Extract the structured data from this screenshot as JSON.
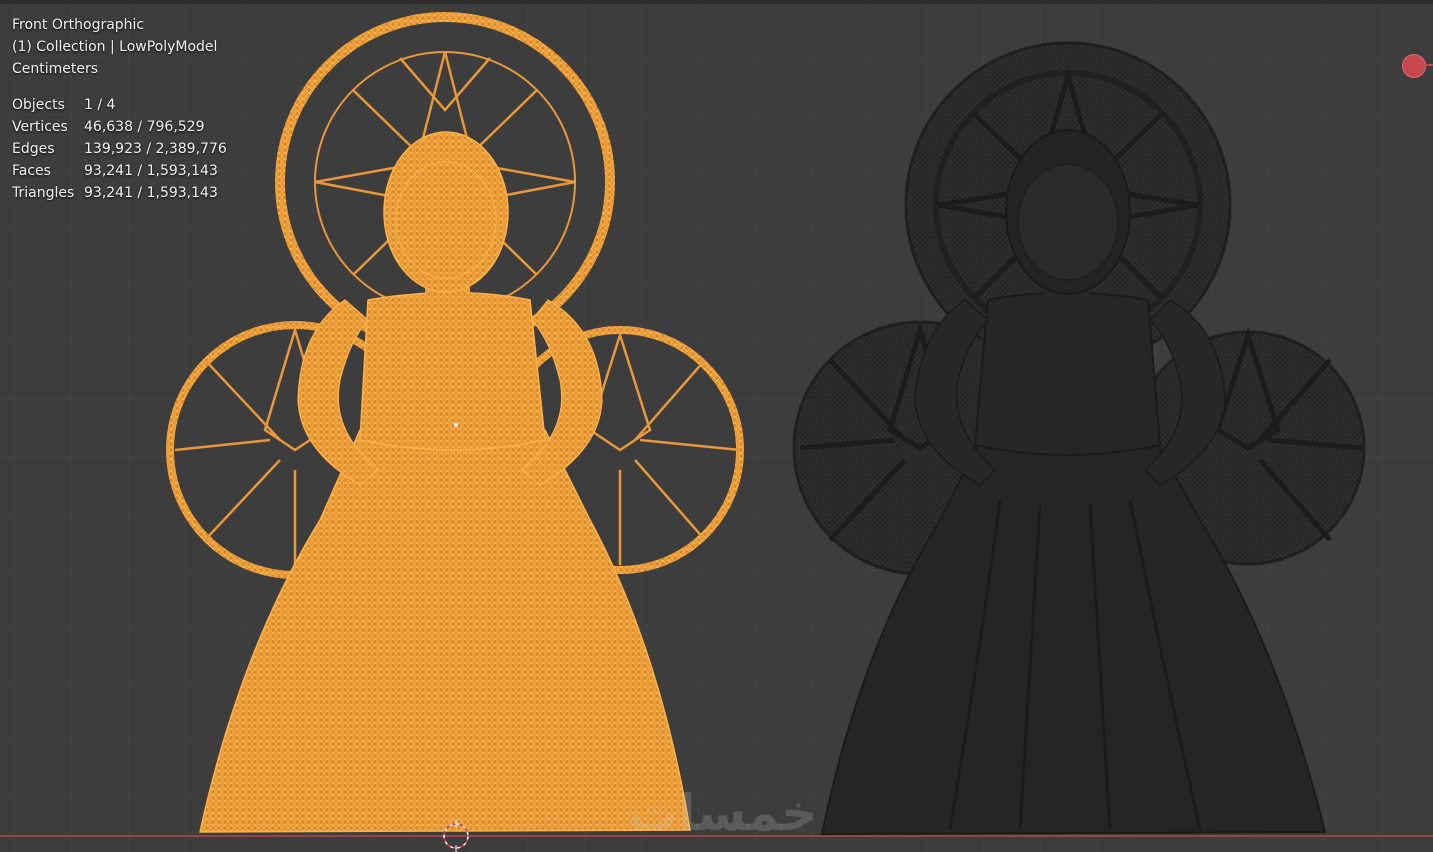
{
  "viewport": {
    "view_name": "Front Orthographic",
    "collection_line": "(1) Collection | LowPolyModel",
    "units": "Centimeters"
  },
  "stats": [
    {
      "label": "Objects",
      "value": "1 / 4"
    },
    {
      "label": "Vertices",
      "value": "46,638 / 796,529"
    },
    {
      "label": "Edges",
      "value": "139,923 / 2,389,776"
    },
    {
      "label": "Faces",
      "value": "93,241 / 1,593,143"
    },
    {
      "label": "Triangles",
      "value": "93,241 / 1,593,143"
    }
  ],
  "watermark": "خمسات",
  "colors": {
    "background": "#3d3d3d",
    "grid": "#474747",
    "selected_wire": "#f5a23c",
    "solid_model": "#262626",
    "x_axis": "#b8454a",
    "gizmo": "#c8474e"
  },
  "icons": {
    "nav_gizmo": "axis-x-icon",
    "cursor": "3d-cursor-icon"
  }
}
